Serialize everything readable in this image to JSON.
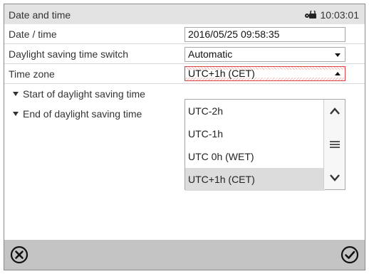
{
  "header": {
    "title": "Date and time",
    "time": "10:03:01",
    "lock_icon": "key-lock-icon"
  },
  "rows": {
    "date_time": {
      "label": "Date / time",
      "value": "2016/05/25 09:58:35"
    },
    "dst_switch": {
      "label": "Daylight saving time switch",
      "value": "Automatic"
    },
    "time_zone": {
      "label": "Time zone",
      "value": "UTC+1h (CET)"
    },
    "dst_start": {
      "label": "Start of daylight saving time"
    },
    "dst_end": {
      "label": "End of daylight saving time"
    }
  },
  "dropdown": {
    "options": [
      "UTC-2h",
      "UTC-1h",
      "UTC 0h (WET)",
      "UTC+1h (CET)"
    ],
    "selected": "UTC+1h (CET)"
  },
  "footer": {
    "cancel_icon": "cancel-x-circle-icon",
    "confirm_icon": "confirm-check-circle-icon"
  },
  "colors": {
    "titlebar": "#e3e3e3",
    "footer": "#c4c4c4",
    "selected_option": "#dcdcdc",
    "active_border": "#dd4444"
  }
}
